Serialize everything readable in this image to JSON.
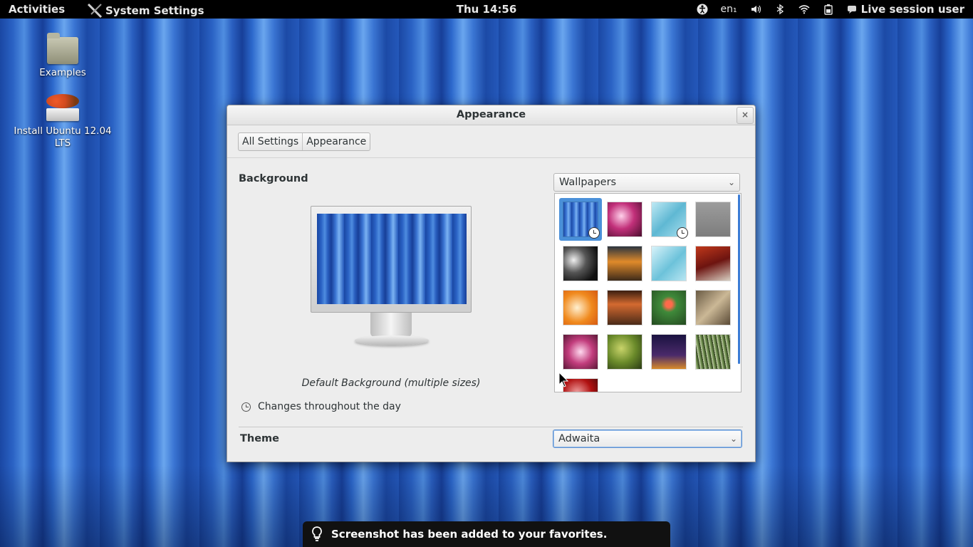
{
  "top_panel": {
    "activities": "Activities",
    "app_menu": "System Settings",
    "clock": "Thu 14:56",
    "keyboard_layout": "en₁",
    "user": "Live session user",
    "tray_icons": [
      "accessibility-icon",
      "keyboard-icon",
      "volume-icon",
      "bluetooth-icon",
      "wifi-icon",
      "battery-icon",
      "user-icon"
    ]
  },
  "desktop": {
    "icons": [
      {
        "label": "Examples",
        "icon": "folder-icon"
      },
      {
        "label": "Install Ubuntu 12.04 LTS",
        "icon": "install-drive-icon"
      }
    ]
  },
  "dialog": {
    "title": "Appearance",
    "close_glyph": "×",
    "breadcrumbs": [
      "All Settings",
      "Appearance"
    ],
    "background": {
      "title": "Background",
      "source_value": "Wallpapers",
      "caption": "Default Background (multiple sizes)",
      "changes_label": "Changes throughout the day",
      "add_label": "+",
      "remove_label": "−",
      "wallpapers": [
        {
          "name": "blue-stripes",
          "selected": true,
          "timed": true
        },
        {
          "name": "pink-bokeh",
          "selected": false,
          "timed": false
        },
        {
          "name": "aqua-waves",
          "selected": false,
          "timed": true
        },
        {
          "name": "grey-fog-deer",
          "selected": false,
          "timed": false
        },
        {
          "name": "dark-shells",
          "selected": false,
          "timed": false
        },
        {
          "name": "sunset-road",
          "selected": false,
          "timed": false
        },
        {
          "name": "aqua-light",
          "selected": false,
          "timed": false
        },
        {
          "name": "autumn-trees",
          "selected": false,
          "timed": false
        },
        {
          "name": "orange-leaves",
          "selected": false,
          "timed": false
        },
        {
          "name": "brown-valley",
          "selected": false,
          "timed": false
        },
        {
          "name": "green-poppies",
          "selected": false,
          "timed": false
        },
        {
          "name": "fountain-pen",
          "selected": false,
          "timed": false
        },
        {
          "name": "pink-flower",
          "selected": false,
          "timed": false
        },
        {
          "name": "green-buds",
          "selected": false,
          "timed": false
        },
        {
          "name": "purple-night-fox",
          "selected": false,
          "timed": false
        },
        {
          "name": "green-grass",
          "selected": false,
          "timed": false
        },
        {
          "name": "red-leaves",
          "selected": false,
          "timed": false
        }
      ]
    },
    "theme": {
      "title": "Theme",
      "value": "Adwaita"
    }
  },
  "notification": {
    "text": "Screenshot has been added to your favorites."
  },
  "colors": {
    "panel": "#000000",
    "selection": "#4a90d9",
    "dialog_bg": "#ededed"
  }
}
